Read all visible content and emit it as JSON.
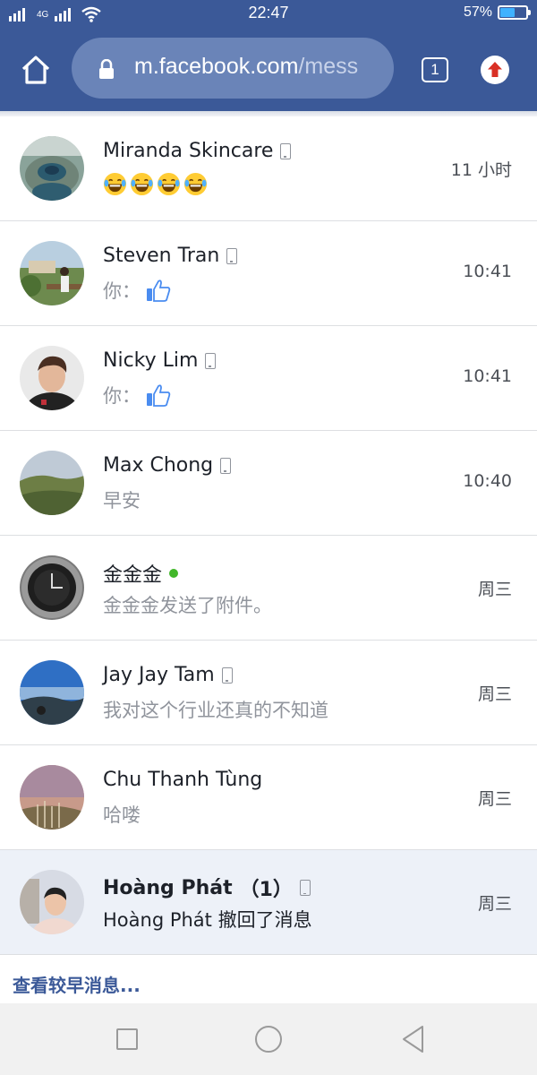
{
  "status_bar": {
    "time": "22:47",
    "battery_percent": "57%",
    "battery_level": 0.57,
    "network_label": "4G"
  },
  "browser": {
    "url_domain": "m.facebook.com",
    "url_path": "/mess",
    "tab_count": "1",
    "colors": {
      "toolbar": "#3b5998",
      "url_bar": "#6a84b8",
      "upload_arrow": "#d93025"
    },
    "icons": [
      "home-icon",
      "lock-icon",
      "tabs-icon",
      "upload-icon"
    ]
  },
  "conversations": [
    {
      "name": "Miranda Skincare",
      "preview": "",
      "emoji_count": 4,
      "time": "11 小时",
      "mobile": true
    },
    {
      "name": "Steven Tran",
      "preview": "你：",
      "like": true,
      "time": "10:41",
      "mobile": true
    },
    {
      "name": "Nicky Lim",
      "preview": "你：",
      "like": true,
      "time": "10:41",
      "mobile": true
    },
    {
      "name": "Max Chong",
      "preview": "早安",
      "time": "10:40",
      "mobile": true
    },
    {
      "name": "金金金",
      "preview": "金金金发送了附件。",
      "time": "周三",
      "online": true
    },
    {
      "name": "Jay Jay Tam",
      "preview": "我对这个行业还真的不知道",
      "time": "周三",
      "mobile": true
    },
    {
      "name": "Chu Thanh Tùng",
      "preview": "哈喽",
      "time": "周三"
    },
    {
      "name": "Hoàng Phát",
      "unread_count": "（1）",
      "preview": "Hoàng Phát 撤回了消息",
      "time": "周三",
      "mobile": true,
      "unread": true
    }
  ],
  "older_messages_link": "查看较早消息...",
  "android_nav": {
    "icons": [
      "recents-square-icon",
      "home-circle-icon",
      "back-triangle-icon"
    ]
  }
}
